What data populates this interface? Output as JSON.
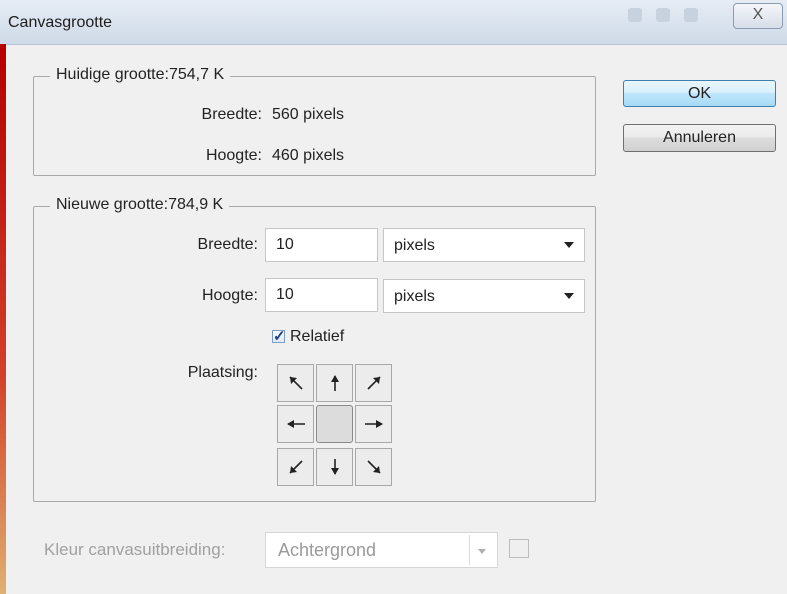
{
  "window": {
    "title": "Canvasgrootte",
    "close_glyph": "X"
  },
  "current_size": {
    "legend": "Huidige grootte:754,7 K",
    "width_label": "Breedte:",
    "width_value": "560 pixels",
    "height_label": "Hoogte:",
    "height_value": "460 pixels"
  },
  "new_size": {
    "legend": "Nieuwe grootte:784,9 K",
    "width_label": "Breedte:",
    "width_value": "10",
    "width_unit": "pixels",
    "height_label": "Hoogte:",
    "height_value": "10",
    "height_unit": "pixels",
    "relative_label": "Relatief",
    "relative_checked": true,
    "anchor_label": "Plaatsing:",
    "anchor_selected": "center"
  },
  "extension_color": {
    "label": "Kleur canvasuitbreiding:",
    "value": "Achtergrond"
  },
  "buttons": {
    "ok": "OK",
    "cancel": "Annuleren"
  },
  "icons": {
    "close": "close-icon",
    "arrows": [
      "arrow-up-left-icon",
      "arrow-up-icon",
      "arrow-up-right-icon",
      "arrow-left-icon",
      "anchor-center",
      "arrow-right-icon",
      "arrow-down-left-icon",
      "arrow-down-icon",
      "arrow-down-right-icon"
    ]
  }
}
